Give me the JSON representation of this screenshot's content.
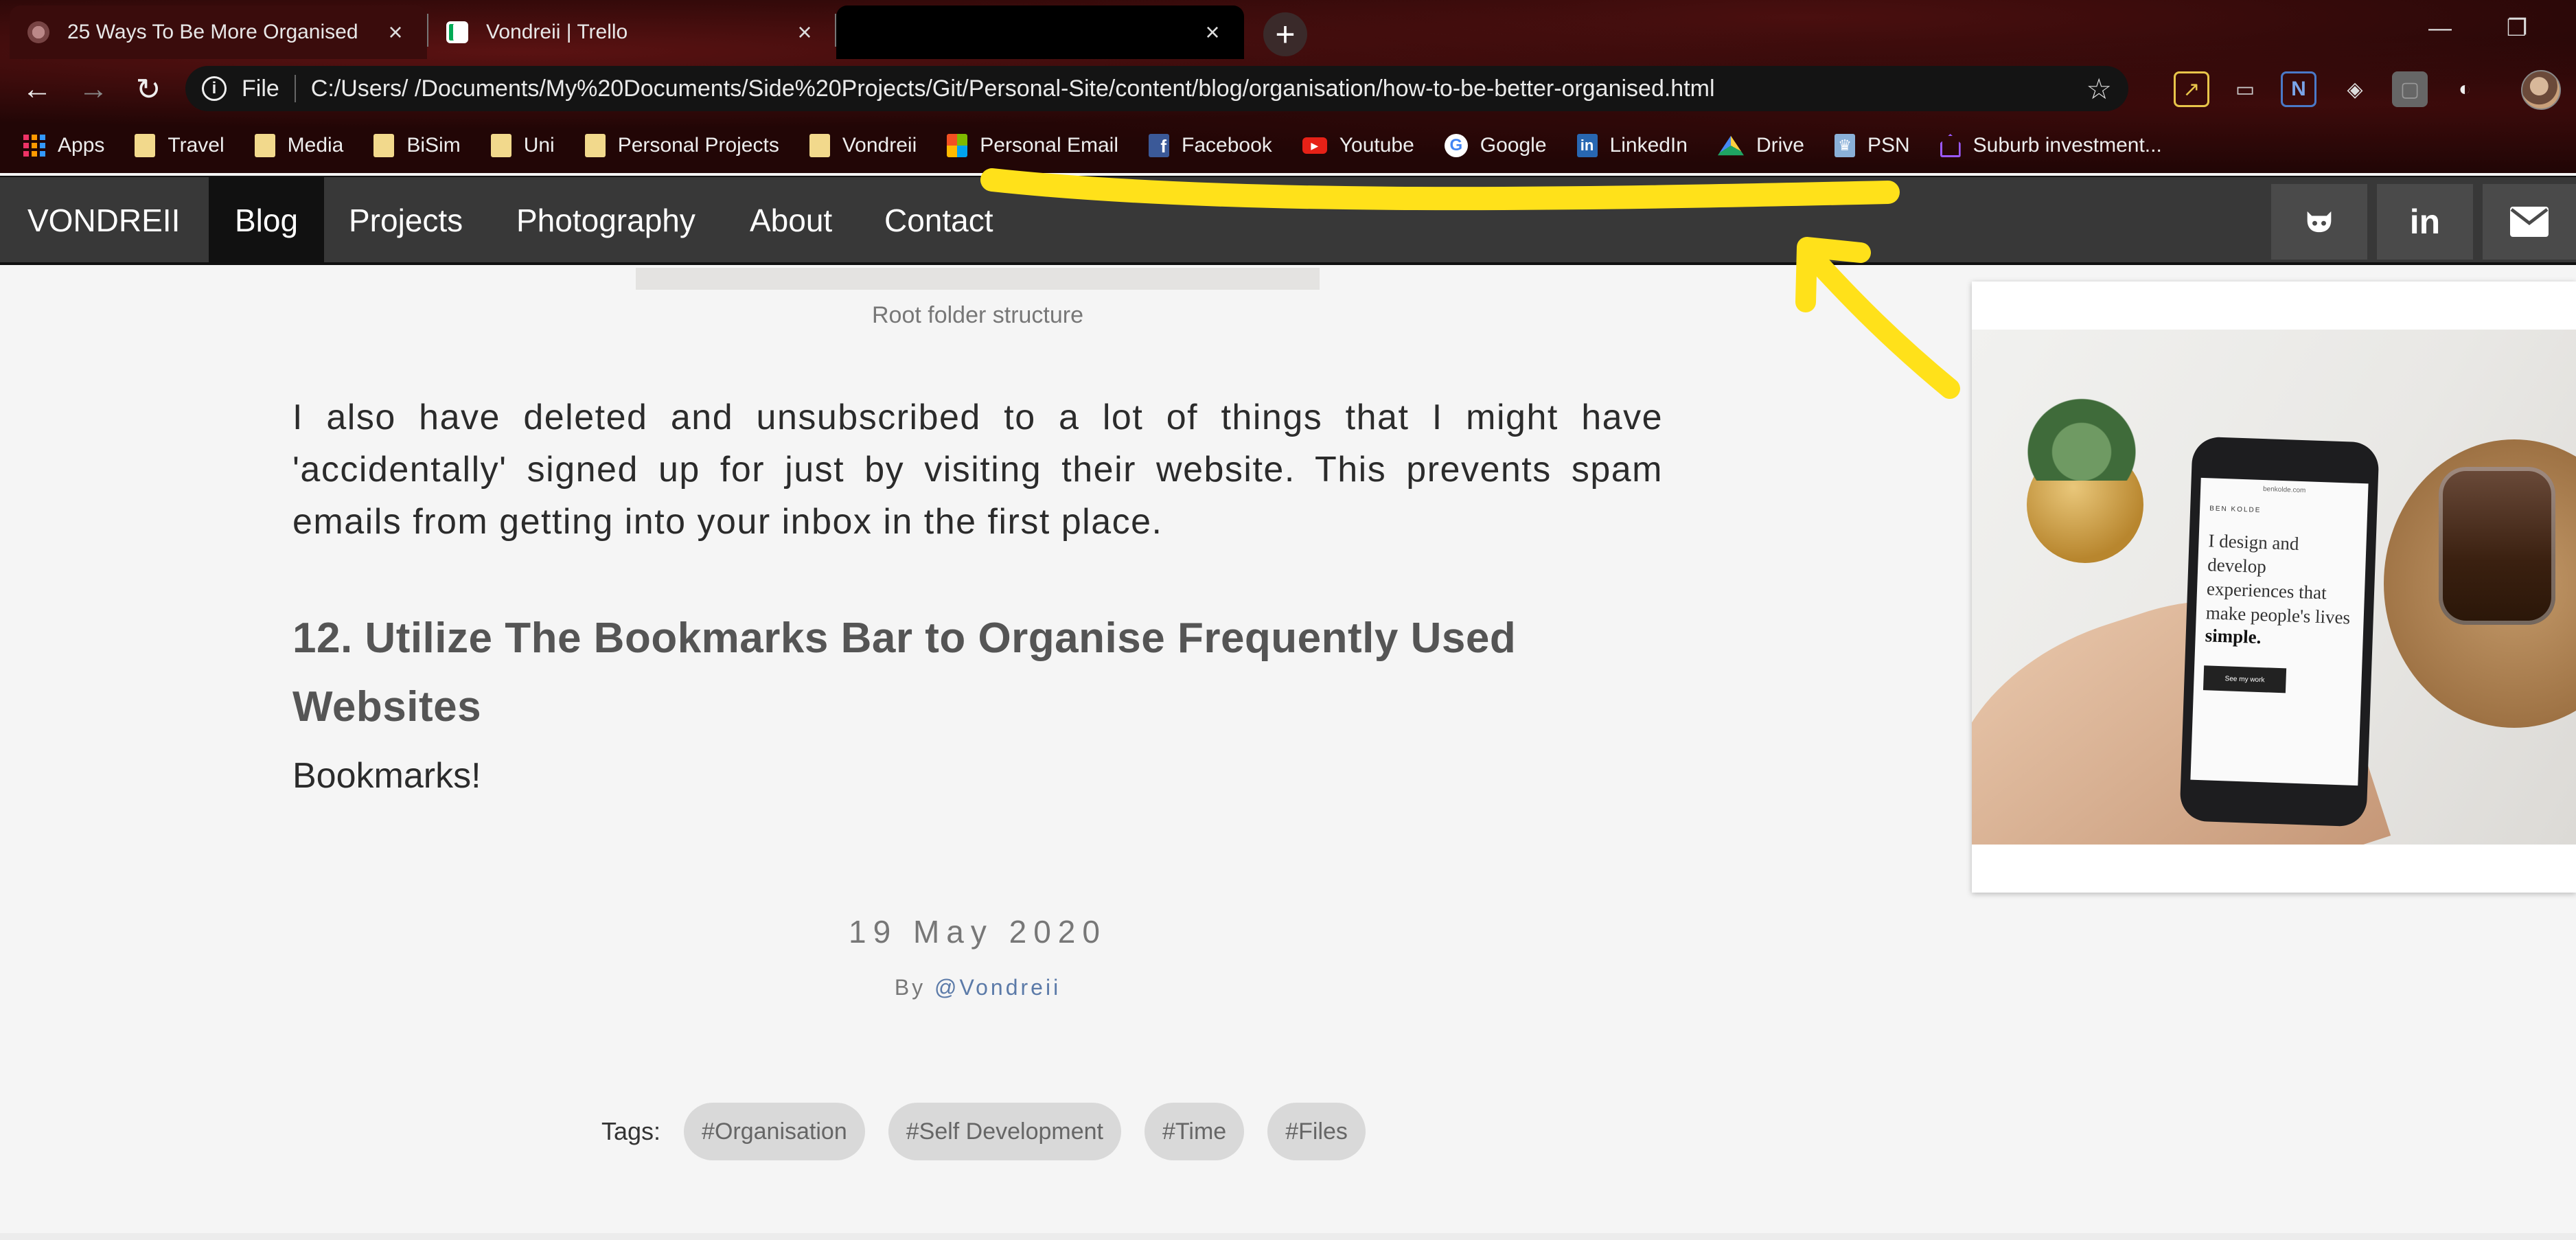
{
  "browser": {
    "tabs": [
      {
        "title": "25 Ways To Be More Organised",
        "active": true
      },
      {
        "title": "Vondreii | Trello",
        "active": false
      },
      {
        "title": "",
        "active": false
      }
    ],
    "new_tab_label": "+",
    "address": {
      "scheme_label": "File",
      "url": "C:/Users/        /Documents/My%20Documents/Side%20Projects/Git/Personal-Site/content/blog/organisation/how-to-be-better-organised.html"
    },
    "bookmarks": [
      {
        "label": "Apps",
        "icon": "apps-grid-icon"
      },
      {
        "label": "Travel",
        "icon": "folder-icon"
      },
      {
        "label": "Media",
        "icon": "folder-icon"
      },
      {
        "label": "BiSim",
        "icon": "folder-icon"
      },
      {
        "label": "Uni",
        "icon": "folder-icon"
      },
      {
        "label": "Personal Projects",
        "icon": "folder-icon"
      },
      {
        "label": "Vondreii",
        "icon": "folder-icon"
      },
      {
        "label": "Personal Email",
        "icon": "microsoft-icon"
      },
      {
        "label": "Facebook",
        "icon": "facebook-icon"
      },
      {
        "label": "Youtube",
        "icon": "youtube-icon"
      },
      {
        "label": "Google",
        "icon": "google-icon"
      },
      {
        "label": "LinkedIn",
        "icon": "linkedin-icon"
      },
      {
        "label": "Drive",
        "icon": "drive-icon"
      },
      {
        "label": "PSN",
        "icon": "trophy-icon"
      },
      {
        "label": "Suburb investment...",
        "icon": "house-icon"
      }
    ]
  },
  "site": {
    "brand": "VONDREII",
    "nav": [
      "Blog",
      "Projects",
      "Photography",
      "About",
      "Contact"
    ],
    "active_nav": "Blog",
    "social_icons": [
      "github-icon",
      "linkedin-icon",
      "mail-icon"
    ]
  },
  "article": {
    "image_caption": "Root folder structure",
    "paragraph": "I also have deleted and unsubscribed to a lot of things that I might have 'accidentally' signed up for just by visiting their website. This prevents spam emails from getting into your inbox in the first place.",
    "heading": "12. Utilize The Bookmarks Bar to Organise Frequently Used Websites",
    "subtext": "Bookmarks!",
    "date": "19 May 2020",
    "by_prefix": "By",
    "author": "@Vondreii",
    "tags_label": "Tags:",
    "tags": [
      "#Organisation",
      "#Self Development",
      "#Time",
      "#Files"
    ]
  },
  "sidebar_image": {
    "phone_brand": "BEN KOLDE",
    "phone_url": "benkolde.com",
    "phone_text": "I design and develop experiences that make people's lives",
    "phone_emphasis": "simple.",
    "phone_button": "See my work"
  },
  "colors": {
    "annotation": "#ffe11a",
    "navbar": "#383838",
    "link": "#5b7aa8"
  }
}
